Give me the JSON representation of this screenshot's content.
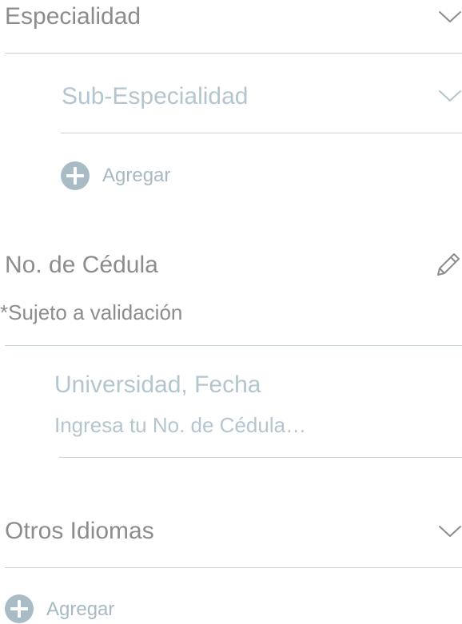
{
  "especialidad": {
    "label": "Especialidad",
    "icon": "chevron-down-icon"
  },
  "sub_especialidad": {
    "label": "Sub-Especialidad",
    "icon": "chevron-down-icon"
  },
  "agregar_especialidad": {
    "label": "Agregar",
    "icon": "plus-circle-icon"
  },
  "cedula": {
    "label": "No. de Cédula",
    "note": "*Sujeto a validación",
    "icon": "pencil-icon"
  },
  "universidad": {
    "label": "Universidad, Fecha",
    "placeholder": "Ingresa tu No. de Cédula…"
  },
  "otros_idiomas": {
    "label": "Otros Idiomas",
    "icon": "chevron-down-icon"
  },
  "agregar_idioma": {
    "label": "Agregar",
    "icon": "plus-circle-icon"
  },
  "colors": {
    "primary_text": "#8c8c8c",
    "muted_text": "#b3c6cf",
    "divider": "#c7d6d4",
    "plus_icon": "#a9bcc6"
  }
}
